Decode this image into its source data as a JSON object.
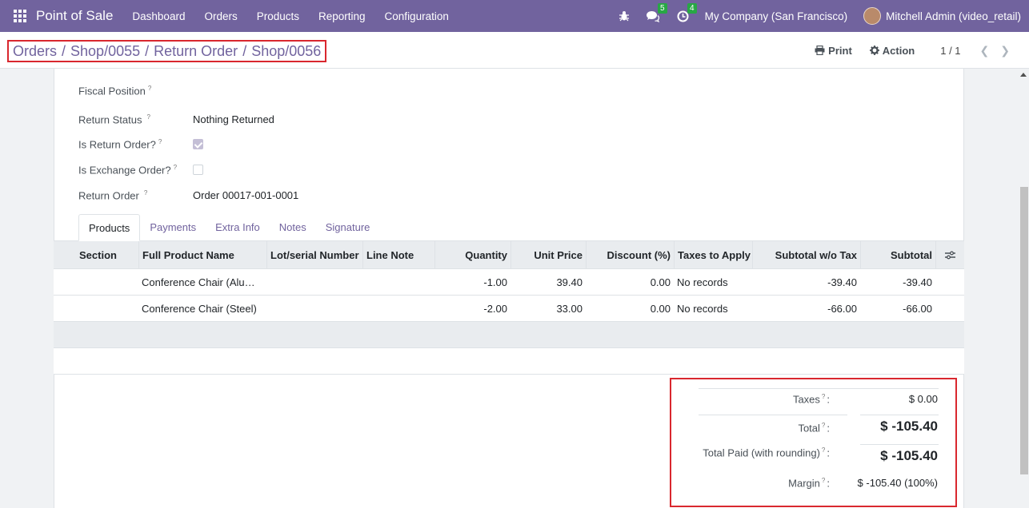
{
  "navbar": {
    "app_name": "Point of Sale",
    "menu": [
      "Dashboard",
      "Orders",
      "Products",
      "Reporting",
      "Configuration"
    ],
    "messages_count": "5",
    "activities_count": "4",
    "company": "My Company (San Francisco)",
    "user": "Mitchell Admin (video_retail)"
  },
  "breadcrumb": {
    "items": [
      "Orders",
      "Shop/0055",
      "Return Order",
      "Shop/0056"
    ],
    "separator": "/"
  },
  "control": {
    "print_label": "Print",
    "action_label": "Action",
    "pager": "1 / 1"
  },
  "fields": {
    "fiscal_position_label": "Fiscal Position",
    "return_status_label": "Return Status",
    "return_status_value": "Nothing Returned",
    "is_return_label": "Is Return Order?",
    "is_return_checked": true,
    "is_exchange_label": "Is Exchange Order?",
    "is_exchange_checked": false,
    "return_order_label": "Return Order",
    "return_order_value": "Order 00017-001-0001",
    "help_mark": "?"
  },
  "tabs": [
    "Products",
    "Payments",
    "Extra Info",
    "Notes",
    "Signature"
  ],
  "table": {
    "headers": [
      "Section",
      "Full Product Name",
      "Lot/serial Number",
      "Line Note",
      "Quantity",
      "Unit Price",
      "Discount (%)",
      "Taxes to Apply",
      "Subtotal w/o Tax",
      "Subtotal"
    ],
    "rows": [
      {
        "name": "Conference Chair (Alu…",
        "lot": "",
        "note": "",
        "qty": "-1.00",
        "price": "39.40",
        "disc": "0.00",
        "taxes": "No records",
        "sub_wo": "-39.40",
        "sub": "-39.40"
      },
      {
        "name": "Conference Chair (Steel)",
        "lot": "",
        "note": "",
        "qty": "-2.00",
        "price": "33.00",
        "disc": "0.00",
        "taxes": "No records",
        "sub_wo": "-66.00",
        "sub": "-66.00"
      }
    ]
  },
  "totals": {
    "taxes_label": "Taxes",
    "taxes_value": "$ 0.00",
    "total_label": "Total",
    "total_value": "$ -105.40",
    "paid_label": "Total Paid (with rounding)",
    "paid_value": "$ -105.40",
    "margin_label": "Margin",
    "margin_value": "$ -105.40 (100%)",
    "colon": ":"
  }
}
